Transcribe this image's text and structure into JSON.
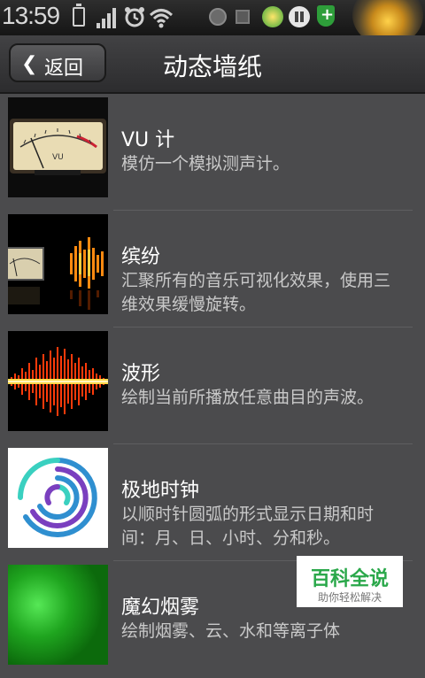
{
  "status_bar": {
    "time": "13:59",
    "icons": [
      "battery-icon",
      "signal-icon",
      "alarm-icon",
      "wifi-icon",
      "app-icon",
      "app-icon",
      "app-icon",
      "pause-icon",
      "shield-icon"
    ]
  },
  "header": {
    "back_label": "返回",
    "title": "动态墙纸"
  },
  "wallpapers": [
    {
      "title": "VU 计",
      "description": "模仿一个模拟测声计。"
    },
    {
      "title": "缤纷",
      "description": "汇聚所有的音乐可视化效果，使用三维效果缓慢旋转。"
    },
    {
      "title": "波形",
      "description": "绘制当前所播放任意曲目的声波。"
    },
    {
      "title": "极地时钟",
      "description": "以顺时针圆弧的形式显示日期和时间：月、日、小时、分和秒。"
    },
    {
      "title": "魔幻烟雾",
      "description": "绘制烟雾、云、水和等离子体"
    }
  ],
  "watermark": {
    "title": "百科全说",
    "subtitle": "助你轻松解决"
  },
  "colors": {
    "background": "#4b4b4d",
    "polar_clock_arcs": [
      "#7a3fbf",
      "#2f8fd0",
      "#3ad0c0"
    ],
    "smoke_green": "#1fa51f",
    "watermark_green": "#2aa84a"
  }
}
